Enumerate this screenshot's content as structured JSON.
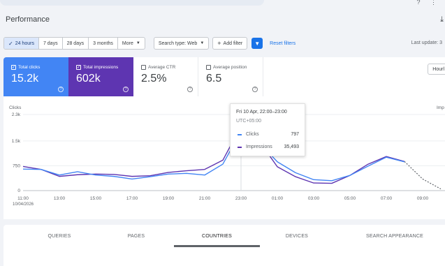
{
  "page": {
    "title": "Performance",
    "last_update": "Last update: 3"
  },
  "filters": {
    "ranges": [
      {
        "label": "24 hours",
        "active": true
      },
      {
        "label": "7 days",
        "active": false
      },
      {
        "label": "28 days",
        "active": false
      },
      {
        "label": "3 months",
        "active": false
      },
      {
        "label": "More",
        "active": false
      }
    ],
    "search_type": "Search type: Web",
    "add_filter": "Add filter",
    "reset": "Reset filters"
  },
  "metrics": [
    {
      "label": "Total clicks",
      "value": "15.2k",
      "checked": true
    },
    {
      "label": "Total impressions",
      "value": "602k",
      "checked": true
    },
    {
      "label": "Average CTR",
      "value": "2.5%",
      "checked": false
    },
    {
      "label": "Average position",
      "value": "6.5",
      "checked": false
    }
  ],
  "view_toggle": "Hourl",
  "colors": {
    "clicks": "#4285f4",
    "impressions": "#5e35b1",
    "accent": "#1a73e8"
  },
  "chart_data": {
    "type": "line",
    "left_axis_label": "Clicks",
    "right_axis_label": "Imp",
    "y_ticks": [
      "2.3k",
      "1.5k",
      "750",
      "0"
    ],
    "y_tick_values": [
      2300,
      1500,
      750,
      0
    ],
    "ylim": [
      0,
      2300
    ],
    "x_labels": [
      "11:00",
      "13:00",
      "15:00",
      "17:00",
      "19:00",
      "21:00",
      "23:00",
      "01:00",
      "03:00",
      "05:00",
      "07:00",
      "09:00"
    ],
    "x_date_label": "10/04/2026",
    "x": [
      "11:00",
      "12:00",
      "13:00",
      "14:00",
      "15:00",
      "16:00",
      "17:00",
      "18:00",
      "19:00",
      "20:00",
      "21:00",
      "22:00",
      "23:00",
      "00:00",
      "01:00",
      "02:00",
      "03:00",
      "04:00",
      "05:00",
      "06:00",
      "07:00",
      "08:00",
      "09:00",
      "10:00"
    ],
    "series": [
      {
        "name": "Clicks",
        "values": [
          650,
          640,
          470,
          570,
          470,
          430,
          350,
          420,
          500,
          520,
          470,
          800,
          1800,
          1450,
          870,
          540,
          330,
          300,
          460,
          740,
          1010,
          870,
          null,
          null
        ]
      },
      {
        "name": "Impressions",
        "values": [
          730,
          640,
          430,
          480,
          500,
          490,
          430,
          450,
          550,
          600,
          640,
          920,
          1950,
          1500,
          720,
          420,
          230,
          220,
          460,
          800,
          1030,
          880,
          350,
          50
        ],
        "dashed_from_index": 21
      }
    ],
    "tooltip": {
      "title": "Fri 10 Apr, 22:00–23:00",
      "timezone": "UTC+05:00",
      "rows": [
        {
          "name": "Clicks",
          "value": "797"
        },
        {
          "name": "Impressions",
          "value": "35,493"
        }
      ]
    },
    "grid": true
  },
  "tabs": [
    {
      "label": "QUERIES",
      "active": false
    },
    {
      "label": "PAGES",
      "active": false
    },
    {
      "label": "COUNTRIES",
      "active": true
    },
    {
      "label": "DEVICES",
      "active": false
    },
    {
      "label": "SEARCH APPEARANCE",
      "active": false
    }
  ]
}
